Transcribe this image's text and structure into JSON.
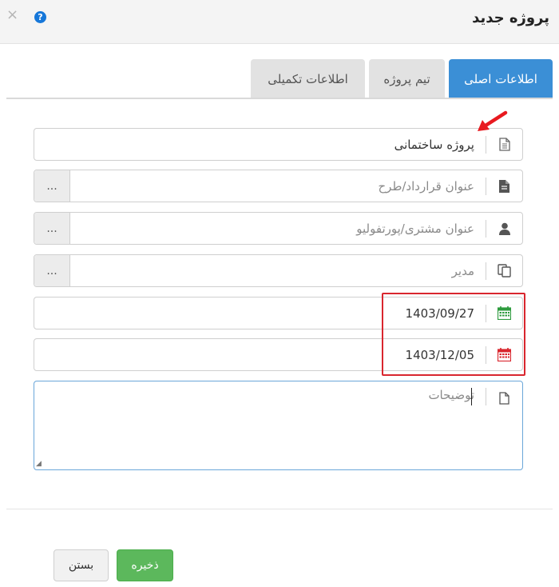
{
  "dialog": {
    "title": "پروژه جدید",
    "close_icon": "close-icon",
    "help_icon": "help-icon",
    "help_glyph": "?"
  },
  "tabs": [
    {
      "label": "اطلاعات اصلی",
      "active": true
    },
    {
      "label": "تیم پروژه",
      "active": false
    },
    {
      "label": "اطلاعات تکمیلی",
      "active": false
    }
  ],
  "form": {
    "project_name": {
      "value": "پروژه ساختمانی",
      "icon": "document-icon"
    },
    "contract": {
      "placeholder": "عنوان قرارداد/طرح",
      "icon": "file-icon",
      "more": "..."
    },
    "customer": {
      "placeholder": "عنوان مشتری/پورتفولیو",
      "icon": "user-icon",
      "more": "..."
    },
    "manager": {
      "placeholder": "مدیر",
      "icon": "copy-icon",
      "more": "..."
    },
    "start_date": {
      "value": "1403/09/27",
      "icon": "calendar-start-icon"
    },
    "end_date": {
      "value": "1403/12/05",
      "icon": "calendar-end-icon"
    },
    "description": {
      "placeholder": "توضیحات",
      "icon": "note-icon"
    }
  },
  "buttons": {
    "save": "ذخیره",
    "close": "بستن"
  },
  "colors": {
    "accent": "#3b8fd6",
    "save": "#5cb85c",
    "highlight": "#d9262e",
    "start_calendar": "#2e9b3e",
    "end_calendar": "#d9262e"
  }
}
